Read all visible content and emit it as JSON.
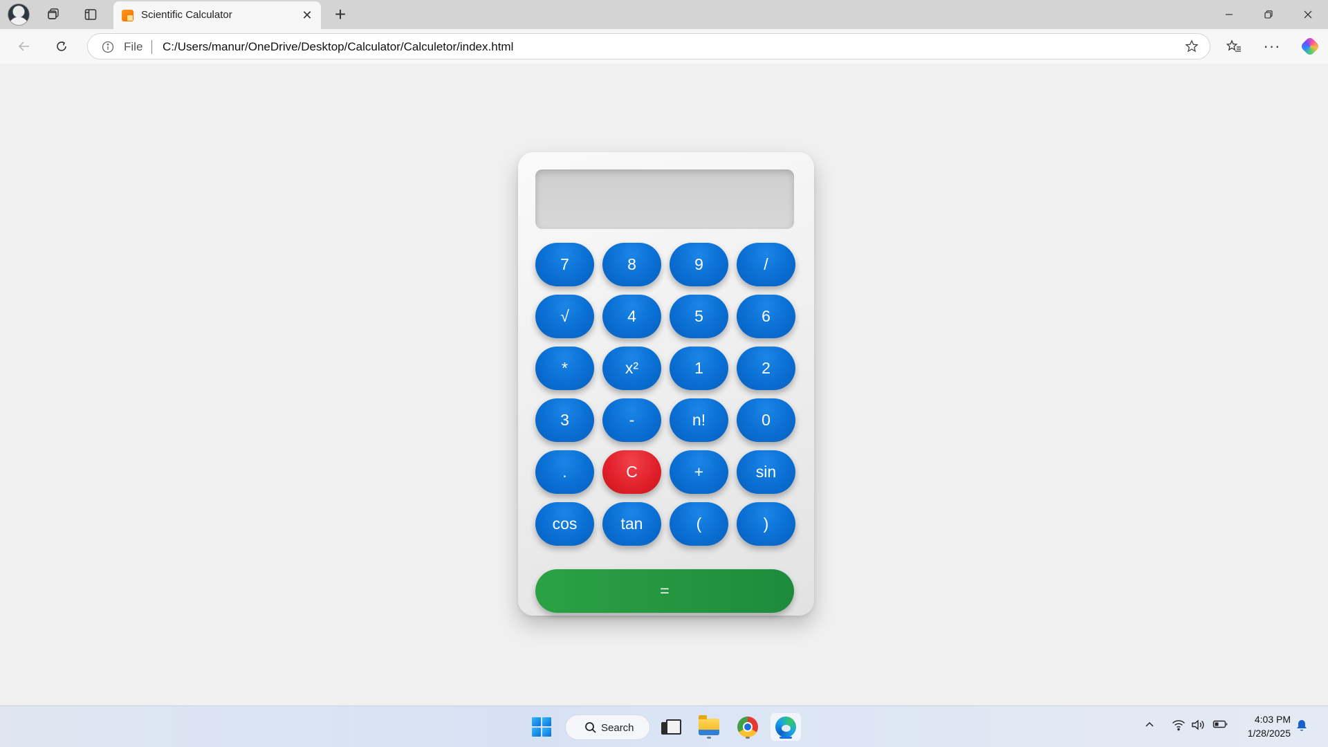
{
  "browser": {
    "tab": {
      "title": "Scientific Calculator",
      "favicon": "calculator-favicon",
      "close_icon": "close-icon"
    },
    "new_tab_icon": "plus-icon",
    "address": {
      "scheme_label": "File",
      "url": "C:/Users/manur/OneDrive/Desktop/Calculator/Calculetor/index.html"
    },
    "icons": [
      "profile-avatar",
      "workspaces-icon",
      "vertical-tabs-icon",
      "back-icon",
      "reload-icon",
      "info-icon",
      "star-icon",
      "favorites-icon",
      "more-icon",
      "copilot-icon",
      "minimize-icon",
      "restore-icon",
      "close-window-icon"
    ]
  },
  "calculator": {
    "display_value": "",
    "keys": [
      {
        "label": "7",
        "variant": "blue"
      },
      {
        "label": "8",
        "variant": "blue"
      },
      {
        "label": "9",
        "variant": "blue"
      },
      {
        "label": "/",
        "variant": "blue"
      },
      {
        "label": "√",
        "variant": "blue"
      },
      {
        "label": "4",
        "variant": "blue"
      },
      {
        "label": "5",
        "variant": "blue"
      },
      {
        "label": "6",
        "variant": "blue"
      },
      {
        "label": "*",
        "variant": "blue"
      },
      {
        "label": "x²",
        "variant": "blue"
      },
      {
        "label": "1",
        "variant": "blue"
      },
      {
        "label": "2",
        "variant": "blue"
      },
      {
        "label": "3",
        "variant": "blue"
      },
      {
        "label": "-",
        "variant": "blue"
      },
      {
        "label": "n!",
        "variant": "blue"
      },
      {
        "label": "0",
        "variant": "blue"
      },
      {
        "label": ".",
        "variant": "blue"
      },
      {
        "label": "C",
        "variant": "red"
      },
      {
        "label": "+",
        "variant": "blue"
      },
      {
        "label": "sin",
        "variant": "blue"
      },
      {
        "label": "cos",
        "variant": "blue"
      },
      {
        "label": "tan",
        "variant": "blue"
      },
      {
        "label": "(",
        "variant": "blue"
      },
      {
        "label": ")",
        "variant": "blue"
      }
    ],
    "equals_label": "=",
    "colors": {
      "key_blue": "#0a6fd4",
      "key_red": "#e01f2a",
      "equals_green": "#23963f",
      "display_bg": "#d3d3d3",
      "body_bg": "#f0f0f0"
    }
  },
  "taskbar": {
    "search_label": "Search",
    "apps": [
      "start-icon",
      "task-view-icon",
      "file-explorer-icon",
      "chrome-icon",
      "edge-icon"
    ],
    "tray": [
      "chevron-up-icon",
      "wifi-icon",
      "volume-icon",
      "battery-icon",
      "notification-bell-icon"
    ],
    "time": "4:03 PM",
    "date": "1/28/2025"
  }
}
